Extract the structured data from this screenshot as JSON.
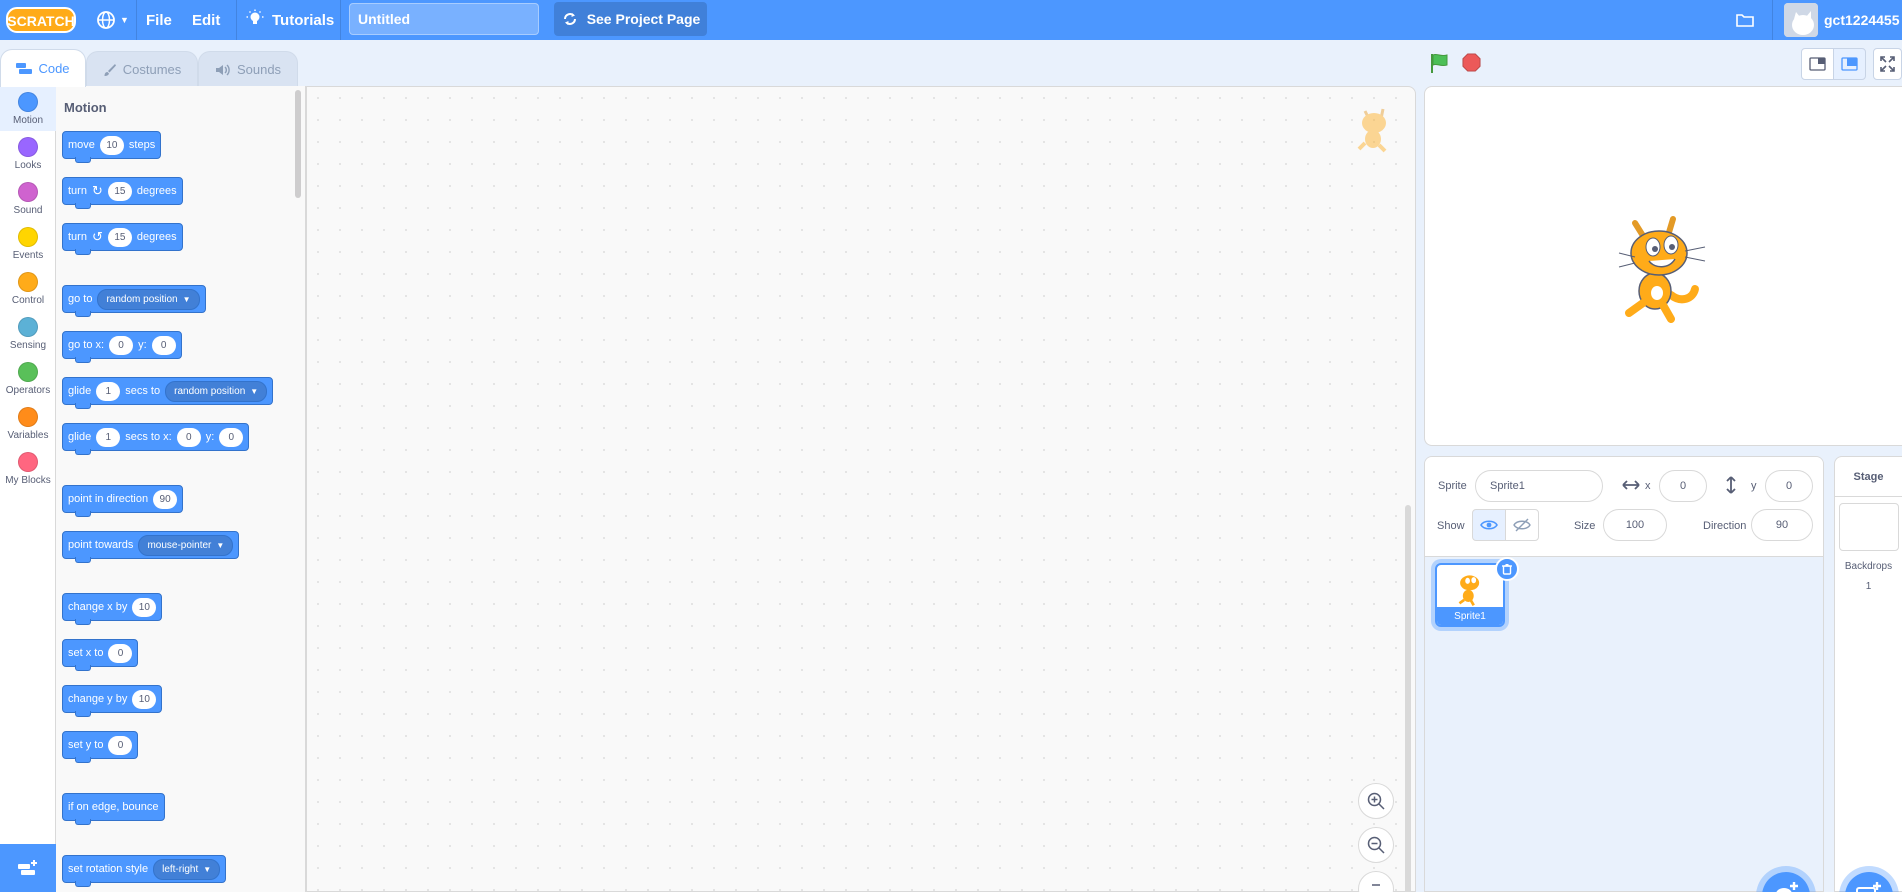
{
  "menubar": {
    "logo": "SCRATCH",
    "file": "File",
    "edit": "Edit",
    "tutorials": "Tutorials",
    "project_title": "Untitled",
    "see_project_page": "See Project Page",
    "username": "gct1224455"
  },
  "tabs": {
    "code": "Code",
    "costumes": "Costumes",
    "sounds": "Sounds"
  },
  "categories": [
    {
      "label": "Motion",
      "color": "#4c97ff"
    },
    {
      "label": "Looks",
      "color": "#9966ff"
    },
    {
      "label": "Sound",
      "color": "#cf63cf"
    },
    {
      "label": "Events",
      "color": "#ffd500"
    },
    {
      "label": "Control",
      "color": "#ffab19"
    },
    {
      "label": "Sensing",
      "color": "#5cb1d6"
    },
    {
      "label": "Operators",
      "color": "#59c059"
    },
    {
      "label": "Variables",
      "color": "#ff8c1a"
    },
    {
      "label": "My Blocks",
      "color": "#ff6680"
    }
  ],
  "flyout": {
    "heading": "Motion",
    "blocks": {
      "move": {
        "a": "move",
        "v1": "10",
        "b": "steps"
      },
      "turn_right": {
        "a": "turn",
        "v1": "15",
        "b": "degrees"
      },
      "turn_left": {
        "a": "turn",
        "v1": "15",
        "b": "degrees"
      },
      "goto": {
        "a": "go to",
        "d1": "random position"
      },
      "goto_xy": {
        "a": "go to x:",
        "v1": "0",
        "b": "y:",
        "v2": "0"
      },
      "glide_to": {
        "a": "glide",
        "v1": "1",
        "b": "secs to",
        "d1": "random position"
      },
      "glide_xy": {
        "a": "glide",
        "v1": "1",
        "b": "secs to x:",
        "v2": "0",
        "c": "y:",
        "v3": "0"
      },
      "point_dir": {
        "a": "point in direction",
        "v1": "90"
      },
      "point_towards": {
        "a": "point towards",
        "d1": "mouse-pointer"
      },
      "change_x": {
        "a": "change x by",
        "v1": "10"
      },
      "set_x": {
        "a": "set x to",
        "v1": "0"
      },
      "change_y": {
        "a": "change y by",
        "v1": "10"
      },
      "set_y": {
        "a": "set y to",
        "v1": "0"
      },
      "bounce": {
        "a": "if on edge, bounce"
      },
      "rotation_style": {
        "a": "set rotation style",
        "d1": "left-right"
      }
    }
  },
  "sprite_info": {
    "sprite_label": "Sprite",
    "sprite_name": "Sprite1",
    "x_label": "x",
    "x_value": "0",
    "y_label": "y",
    "y_value": "0",
    "show_label": "Show",
    "size_label": "Size",
    "size_value": "100",
    "direction_label": "Direction",
    "direction_value": "90"
  },
  "sprites": [
    {
      "name": "Sprite1",
      "selected": true
    }
  ],
  "stage_pane": {
    "title": "Stage",
    "backdrops_label": "Backdrops",
    "backdrops_count": "1"
  }
}
